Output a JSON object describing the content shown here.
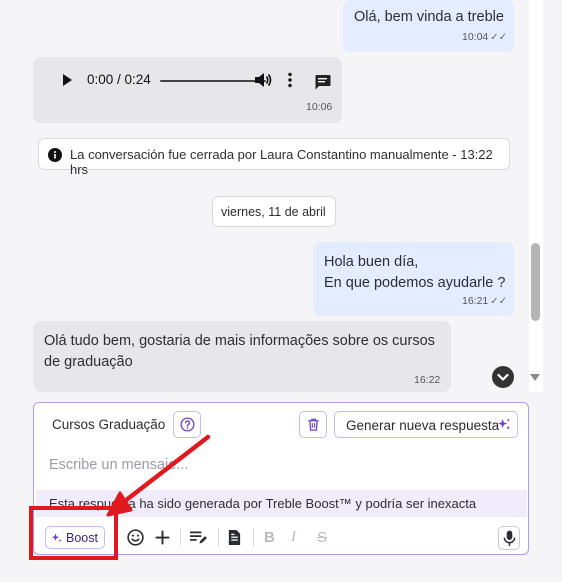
{
  "messages": [
    {
      "direction": "out",
      "text": "Olá, bem vinda a treble",
      "time": "10:04",
      "status": "read"
    },
    {
      "direction": "in",
      "type": "audio",
      "audio_time": "0:00 / 0:24",
      "time": "10:06"
    },
    {
      "type": "system",
      "text": "La conversación fue cerrada por Laura Constantino manualmente - 13:22 hrs"
    },
    {
      "type": "date",
      "text": "viernes, 11 de abril"
    },
    {
      "direction": "out",
      "lines": [
        "Hola buen día,",
        "En que podemos ayudarle ?"
      ],
      "time": "16:21",
      "status": "read"
    },
    {
      "direction": "in",
      "lines": [
        "Olá tudo bem, gostaria de mais informações sobre os cursos",
        "de graduação"
      ],
      "time": "16:22"
    }
  ],
  "composer": {
    "tag_label": "Cursos Graduação",
    "generate_label": "Generar nueva respuesta",
    "placeholder": "Escribe un mensaje...",
    "disclaimer": "Esta respuesta ha sido generada por Treble Boost™ y podría ser inexacta",
    "boost_label": "Boost"
  },
  "colors": {
    "accent": "#7b52d6",
    "outgoing_bubble": "#e4ecff",
    "incoming_bubble": "#e7e7ea",
    "annotation_red": "#e0191f"
  },
  "icons": [
    "info-icon",
    "play-icon",
    "volume-icon",
    "more-vertical-icon",
    "transcript-icon",
    "help-icon",
    "trash-icon",
    "sparkle-icon",
    "chevron-down-icon",
    "emoji-icon",
    "plus-icon",
    "text-edit-icon",
    "document-icon",
    "bold-icon",
    "italic-icon",
    "strikethrough-icon",
    "microphone-icon"
  ]
}
